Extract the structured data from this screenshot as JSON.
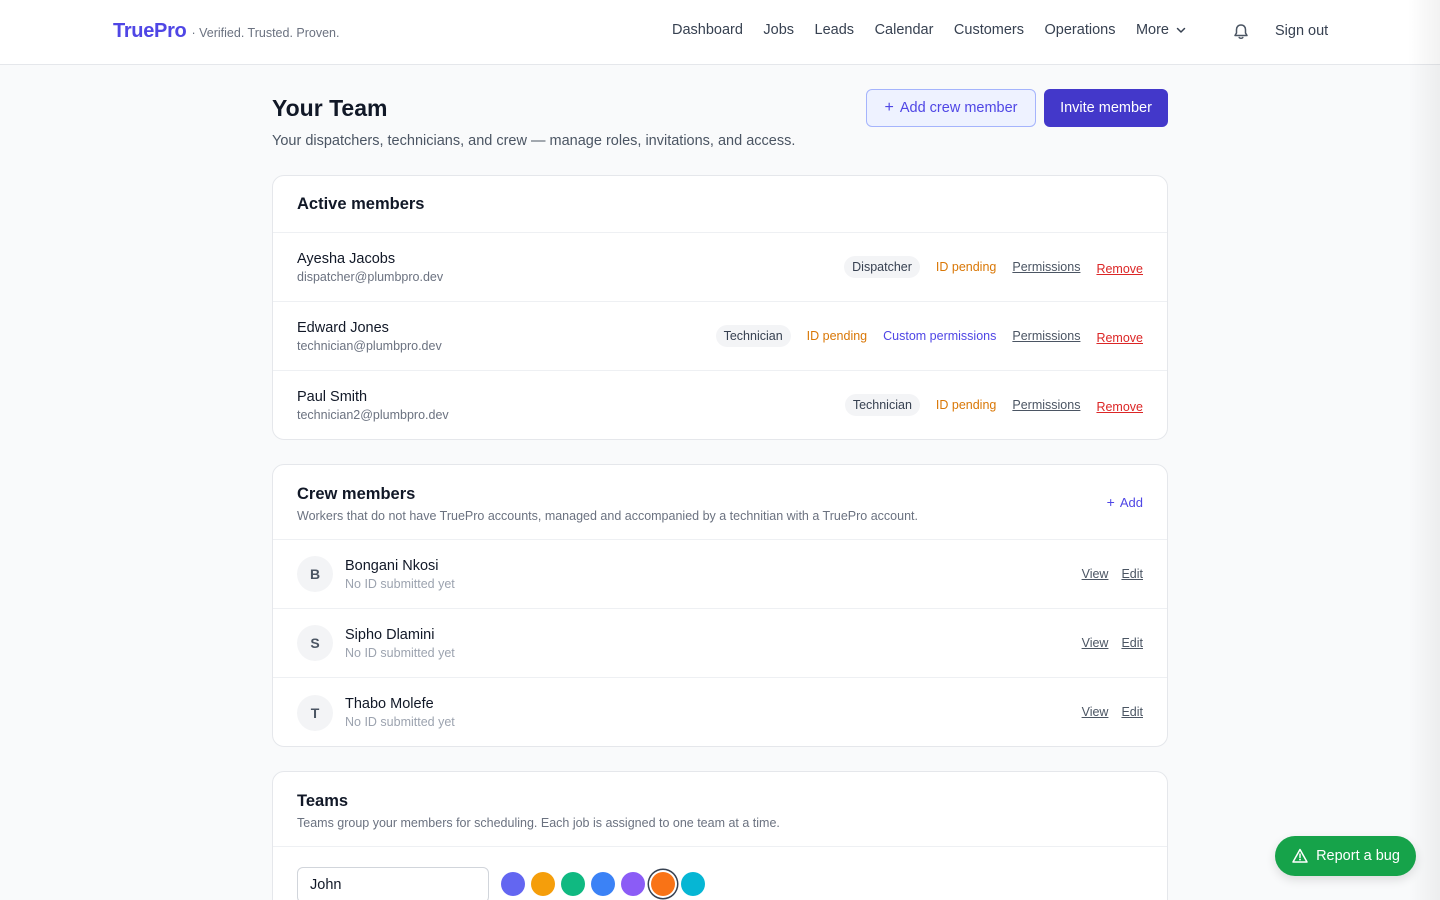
{
  "brand": {
    "name": "TruePro",
    "tagline": "· Verified. Trusted. Proven."
  },
  "nav": {
    "items": [
      "Dashboard",
      "Jobs",
      "Leads",
      "Calendar",
      "Customers",
      "Operations",
      "More"
    ],
    "signout": "Sign out"
  },
  "page": {
    "title": "Your Team",
    "subtitle": "Your dispatchers, technicians, and crew — manage roles, invitations, and access.",
    "add_crew_label": "Add crew member",
    "invite_label": "Invite member"
  },
  "active": {
    "title": "Active members",
    "members": [
      {
        "name": "Ayesha Jacobs",
        "email": "dispatcher@plumbpro.dev",
        "role": "Dispatcher",
        "status": "ID pending",
        "custom": "",
        "permissions": "Permissions",
        "remove": "Remove"
      },
      {
        "name": "Edward Jones",
        "email": "technician@plumbpro.dev",
        "role": "Technician",
        "status": "ID pending",
        "custom": "Custom permissions",
        "permissions": "Permissions",
        "remove": "Remove"
      },
      {
        "name": "Paul Smith",
        "email": "technician2@plumbpro.dev",
        "role": "Technician",
        "status": "ID pending",
        "custom": "",
        "permissions": "Permissions",
        "remove": "Remove"
      }
    ]
  },
  "crew": {
    "title": "Crew members",
    "description": "Workers that do not have TruePro accounts, managed and accompanied by a technitian with a TruePro account.",
    "add_label": "Add",
    "members": [
      {
        "initial": "B",
        "name": "Bongani Nkosi",
        "status": "No ID submitted yet",
        "view": "View",
        "edit": "Edit"
      },
      {
        "initial": "S",
        "name": "Sipho Dlamini",
        "status": "No ID submitted yet",
        "view": "View",
        "edit": "Edit"
      },
      {
        "initial": "T",
        "name": "Thabo Molefe",
        "status": "No ID submitted yet",
        "view": "View",
        "edit": "Edit"
      }
    ]
  },
  "teams": {
    "title": "Teams",
    "description": "Teams group your members for scheduling. Each job is assigned to one team at a time.",
    "input_value": "John",
    "colors": [
      "#6366f1",
      "#f59e0b",
      "#10b981",
      "#3b82f6",
      "#8b5cf6",
      "#f97316",
      "#06b6d4"
    ],
    "selected_color": "#f97316"
  },
  "bug_report": {
    "label": "Report a bug"
  }
}
